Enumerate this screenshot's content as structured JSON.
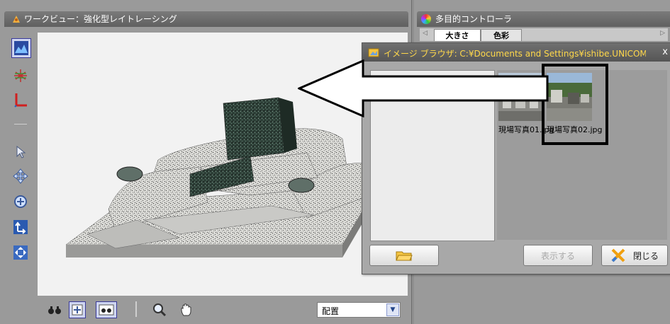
{
  "work_view": {
    "title": "ワークビュー：強化型レイトレーシング",
    "left_tools": [
      "histogram-icon",
      "grid-icon",
      "axes-icon",
      "separator",
      "pointer-icon",
      "move-icon",
      "rotate-icon",
      "up-arrow-icon",
      "fit-icon"
    ],
    "bottom_tools": [
      "binoculars-icon",
      "zoom-fit-icon",
      "binoculars-frame-icon",
      "magnifier-icon",
      "hand-icon"
    ],
    "placement_select": {
      "value": "配置"
    }
  },
  "controller": {
    "title": "多目的コントローラ",
    "tabs": [
      {
        "label": "大きさ",
        "active": true
      },
      {
        "label": "色彩",
        "active": false
      }
    ]
  },
  "image_browser": {
    "title": "イメージ ブラウザ: C:¥Documents and Settings¥ishibe.UNICOMDOM...",
    "close_glyph": "x",
    "thumbnails": [
      {
        "label": "現場写真01.jpg"
      },
      {
        "label": "現場写真02.jpg"
      }
    ],
    "buttons": {
      "show": "表示する",
      "close": "閉じる"
    }
  },
  "colors": {
    "titlebar": "#656565",
    "canvas": "#f2f2f2",
    "dialog_title_text": "#ffd84a"
  }
}
